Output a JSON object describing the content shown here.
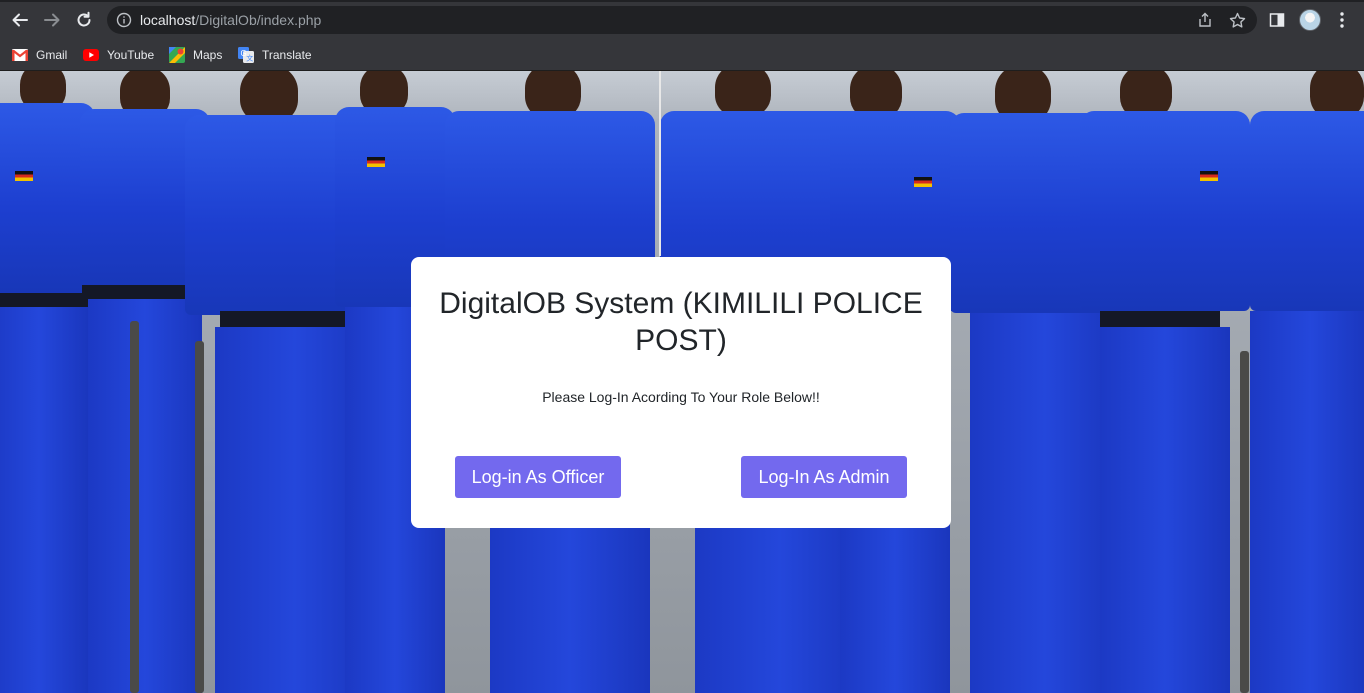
{
  "browser": {
    "url_host": "localhost",
    "url_path": "/DigitalOb/index.php",
    "bookmarks": [
      {
        "label": "Gmail",
        "icon": "gmail-icon"
      },
      {
        "label": "YouTube",
        "icon": "youtube-icon"
      },
      {
        "label": "Maps",
        "icon": "maps-icon"
      },
      {
        "label": "Translate",
        "icon": "translate-icon"
      }
    ]
  },
  "login": {
    "title": "DigitalOB System (KIMILILI POLICE POST)",
    "subtitle": "Please Log-In Acording To Your Role Below!!",
    "officer_button": "Log-in As Officer",
    "admin_button": "Log-In As Admin"
  },
  "colors": {
    "button": "#7369ee",
    "uniform": "#1f45d6",
    "chrome": "#35363a"
  }
}
